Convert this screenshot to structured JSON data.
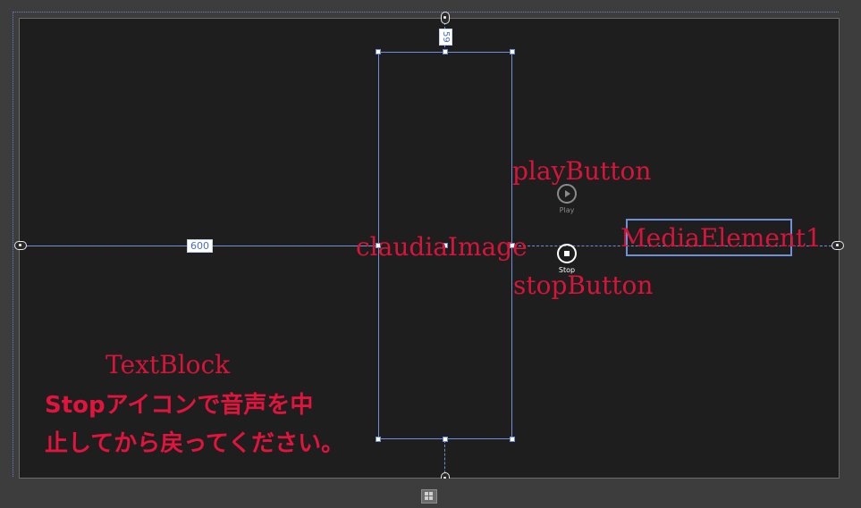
{
  "designer": {
    "dimensions": {
      "top_margin": "59",
      "left_margin": "600"
    },
    "labels": {
      "play_button_name": "playButton",
      "stop_button_name": "stopButton",
      "image_name": "claudiaImage",
      "media_element_name": "MediaElement1",
      "textblock_name": "TextBlock"
    }
  },
  "app": {
    "play_button": {
      "caption": "Play",
      "icon": "play-icon"
    },
    "stop_button": {
      "caption": "Stop",
      "icon": "stop-icon"
    },
    "textblock_text_line1": "Stopアイコンで音声を中",
    "textblock_text_line2": "止してから戻ってください。"
  },
  "colors": {
    "canvas_bg": "#1e1e1e",
    "selection_blue": "#6f8fd8",
    "label_red": "#d7143a",
    "frame_bg": "#3d3d3d"
  },
  "icons": {
    "windows_button": "windows-logo-icon",
    "pin": "anchor-pin-icon"
  }
}
